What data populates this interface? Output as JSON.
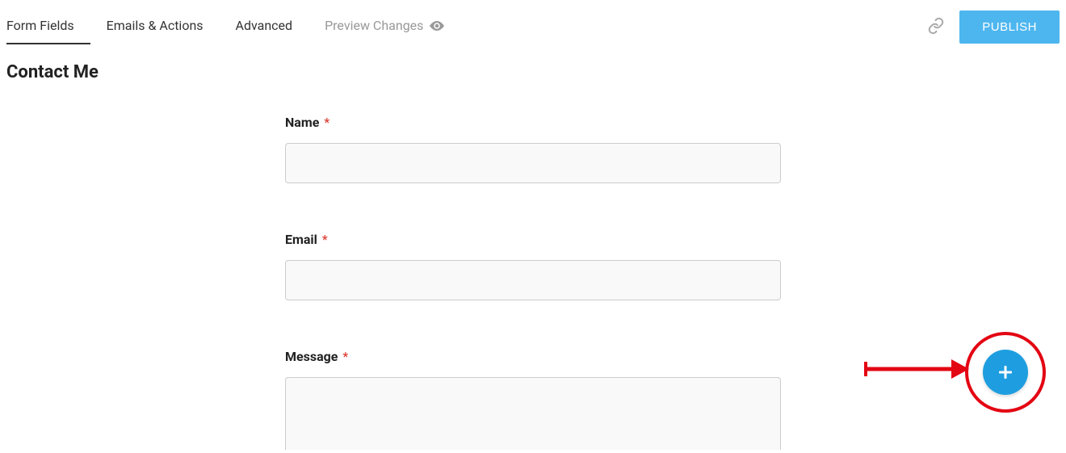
{
  "tabs": {
    "formFields": "Form Fields",
    "emailsActions": "Emails & Actions",
    "advanced": "Advanced",
    "previewChanges": "Preview Changes"
  },
  "header": {
    "publish": "PUBLISH"
  },
  "pageTitle": "Contact Me",
  "fields": {
    "name": {
      "label": "Name",
      "required": "*",
      "value": ""
    },
    "email": {
      "label": "Email",
      "required": "*",
      "value": ""
    },
    "message": {
      "label": "Message",
      "required": "*",
      "value": ""
    }
  }
}
